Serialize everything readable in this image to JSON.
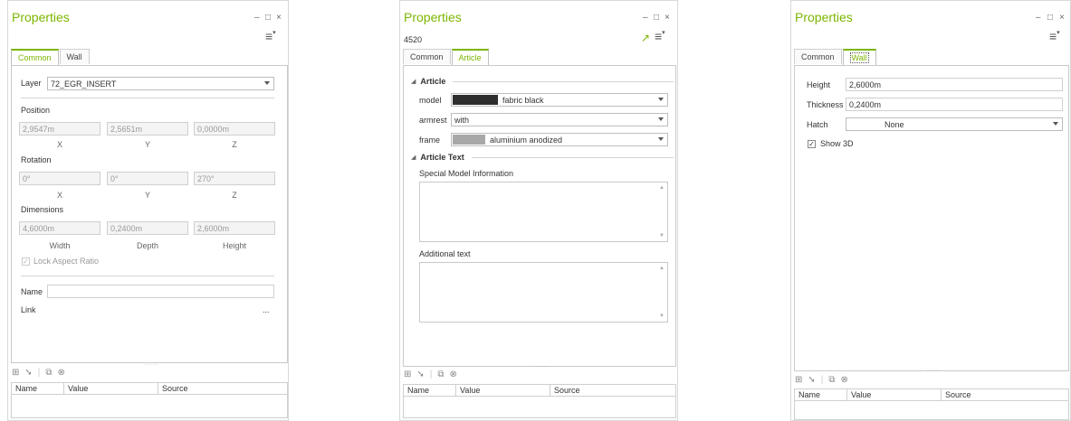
{
  "window_controls": {
    "minimize": "–",
    "maximize": "□",
    "close": "×"
  },
  "panel1": {
    "title": "Properties",
    "tabs": [
      "Common",
      "Wall"
    ],
    "layer": {
      "label": "Layer",
      "value": "72_EGR_INSERT"
    },
    "position": {
      "label": "Position",
      "x": "2,9547m",
      "y": "2,5651m",
      "z": "0,0000m"
    },
    "rotation": {
      "label": "Rotation",
      "x": "0°",
      "y": "0°",
      "z": "270°"
    },
    "axes": {
      "x": "X",
      "y": "Y",
      "z": "Z"
    },
    "dimensions": {
      "label": "Dimensions",
      "width": "4,6000m",
      "depth": "0,2400m",
      "height": "2,6000m",
      "width_label": "Width",
      "depth_label": "Depth",
      "height_label": "Height"
    },
    "lock_aspect_label": "Lock Aspect Ratio",
    "name_label": "Name",
    "name_value": "",
    "link_label": "Link",
    "link_more": "...",
    "grid_headers": [
      "Name",
      "Value",
      "Source"
    ]
  },
  "panel2": {
    "title": "Properties",
    "id": "4520",
    "tabs": [
      "Common",
      "Article"
    ],
    "section_article": "Article",
    "model": {
      "label": "model",
      "value": "fabric black"
    },
    "armrest": {
      "label": "armrest",
      "value": "with"
    },
    "frame": {
      "label": "frame",
      "value": "aluminium anodized"
    },
    "section_text": "Article Text",
    "special_label": "Special Model Information",
    "additional_label": "Additional text",
    "grid_headers": [
      "Name",
      "Value",
      "Source"
    ],
    "colors": {
      "accent": "#7cb500",
      "model_swatch": "#2e2e2e",
      "frame_swatch": "#a8a8a8"
    }
  },
  "panel3": {
    "title": "Properties",
    "tabs": [
      "Common",
      "Wall"
    ],
    "height": {
      "label": "Height",
      "value": "2,6000m"
    },
    "thickness": {
      "label": "Thickness",
      "value": "0,2400m"
    },
    "hatch": {
      "label": "Hatch",
      "value": "None"
    },
    "show3d_label": "Show 3D",
    "grid_headers": [
      "Name",
      "Value",
      "Source"
    ]
  },
  "icons": [
    "menu-icon",
    "pin-icon",
    "add-icon",
    "pointer-icon",
    "copy-icon",
    "delete-icon",
    "checkbox-icon",
    "collapse-triangle-icon"
  ]
}
